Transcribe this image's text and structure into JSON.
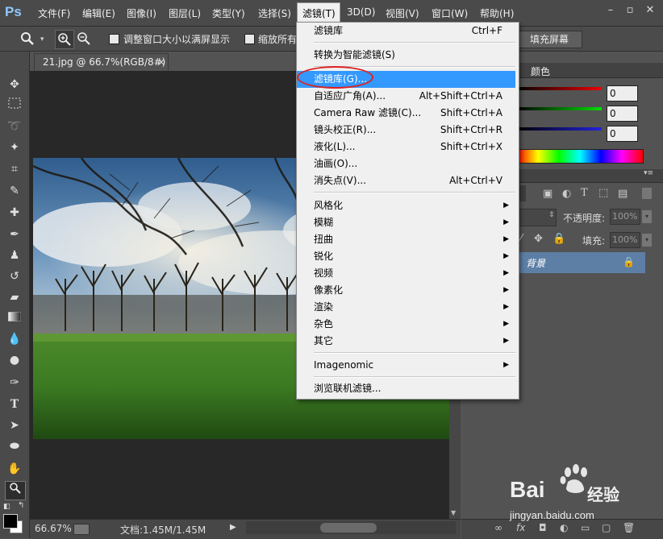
{
  "app": {
    "logo": "Ps"
  },
  "menubar": {
    "items": [
      "文件(F)",
      "编辑(E)",
      "图像(I)",
      "图层(L)",
      "类型(Y)",
      "选择(S)",
      "滤镜(T)",
      "3D(D)",
      "视图(V)",
      "窗口(W)",
      "帮助(H)"
    ],
    "active": "滤镜(T)"
  },
  "window_controls": {
    "minimize": "–",
    "restore": "▫",
    "close": "✕"
  },
  "options": {
    "check1_label": "调整窗口大小以满屏显示",
    "check2_label": "缩放所有",
    "fullscreen_label": "填充屏幕"
  },
  "document": {
    "tab_title": "21.jpg @ 66.7%(RGB/8#)",
    "tab_close": "×",
    "zoom": "66.67%",
    "doc_info": "文档:1.45M/1.45M"
  },
  "panels": {
    "color_tab": "颜色",
    "rgb_values": [
      "0",
      "0",
      "0"
    ],
    "opacity_label": "不透明度:",
    "opacity_value": "100%",
    "fill_label": "填充:",
    "fill_value": "100%",
    "layer_name": "背景"
  },
  "filter_menu": {
    "items": [
      {
        "label": "滤镜库",
        "shortcut": "Ctrl+F",
        "submenu": false
      },
      {
        "sep": true
      },
      {
        "label": "转换为智能滤镜(S)",
        "shortcut": "",
        "submenu": false
      },
      {
        "sep": true
      },
      {
        "label": "滤镜库(G)...",
        "shortcut": "",
        "submenu": false,
        "highlighted": true
      },
      {
        "label": "自适应广角(A)...",
        "shortcut": "Alt+Shift+Ctrl+A",
        "submenu": false
      },
      {
        "label": "Camera Raw 滤镜(C)...",
        "shortcut": "Shift+Ctrl+A",
        "submenu": false
      },
      {
        "label": "镜头校正(R)...",
        "shortcut": "Shift+Ctrl+R",
        "submenu": false
      },
      {
        "label": "液化(L)...",
        "shortcut": "Shift+Ctrl+X",
        "submenu": false
      },
      {
        "label": "油画(O)...",
        "shortcut": "",
        "submenu": false
      },
      {
        "label": "消失点(V)...",
        "shortcut": "Alt+Ctrl+V",
        "submenu": false
      },
      {
        "sep": true
      },
      {
        "label": "风格化",
        "shortcut": "",
        "submenu": true
      },
      {
        "label": "模糊",
        "shortcut": "",
        "submenu": true
      },
      {
        "label": "扭曲",
        "shortcut": "",
        "submenu": true
      },
      {
        "label": "锐化",
        "shortcut": "",
        "submenu": true
      },
      {
        "label": "视频",
        "shortcut": "",
        "submenu": true
      },
      {
        "label": "像素化",
        "shortcut": "",
        "submenu": true
      },
      {
        "label": "渲染",
        "shortcut": "",
        "submenu": true
      },
      {
        "label": "杂色",
        "shortcut": "",
        "submenu": true
      },
      {
        "label": "其它",
        "shortcut": "",
        "submenu": true
      },
      {
        "sep": true
      },
      {
        "label": "Imagenomic",
        "shortcut": "",
        "submenu": true
      },
      {
        "sep": true
      },
      {
        "label": "浏览联机滤镜...",
        "shortcut": "",
        "submenu": false
      }
    ]
  },
  "watermark": {
    "brand": "Bai",
    "brand2": "经验",
    "url": "jingyan.baidu.com"
  },
  "colors": {
    "highlight": "#3399ff",
    "circle": "#dd2222",
    "layer_selected": "#5d7fa6"
  }
}
